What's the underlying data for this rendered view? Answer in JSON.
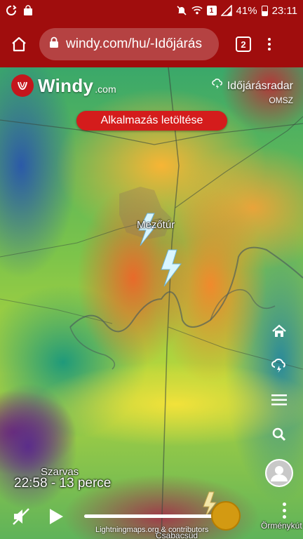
{
  "status_bar": {
    "battery_percent": "41%",
    "clock": "23:11",
    "sim_badge": "1",
    "icons": [
      "sync-icon",
      "shopping-bag-icon",
      "mute-icon",
      "wifi-icon",
      "sim-icon",
      "signal-icon",
      "battery-icon"
    ]
  },
  "browser": {
    "url": "windy.com/hu/-Időjárás",
    "tab_count": "2",
    "icons": [
      "home-icon",
      "lock-icon",
      "tab-switcher-icon",
      "more-icon"
    ]
  },
  "app": {
    "logo_text": "Windy",
    "logo_suffix": ".com",
    "layer_name": "Időjárásradar",
    "layer_source": "OMSZ",
    "download_button": "Alkalmazás letöltése"
  },
  "map": {
    "cities": {
      "mezotur": "Mezőtúr",
      "szarvas": "Szarvas",
      "orm": "Örménykút",
      "csab": "Csabacsüd"
    },
    "colors": {
      "brand_red": "#a00d0d",
      "button_red": "#d41c1c",
      "knob": "#d39a12"
    }
  },
  "toolbar": {
    "icons": [
      "home-icon",
      "lightning-cloud-icon",
      "menu-icon",
      "search-icon",
      "avatar-icon"
    ]
  },
  "timeline": {
    "time_label": "22:58 - 13 perce",
    "progress": 0.92,
    "attribution": "Lightningmaps.org & contributors"
  }
}
